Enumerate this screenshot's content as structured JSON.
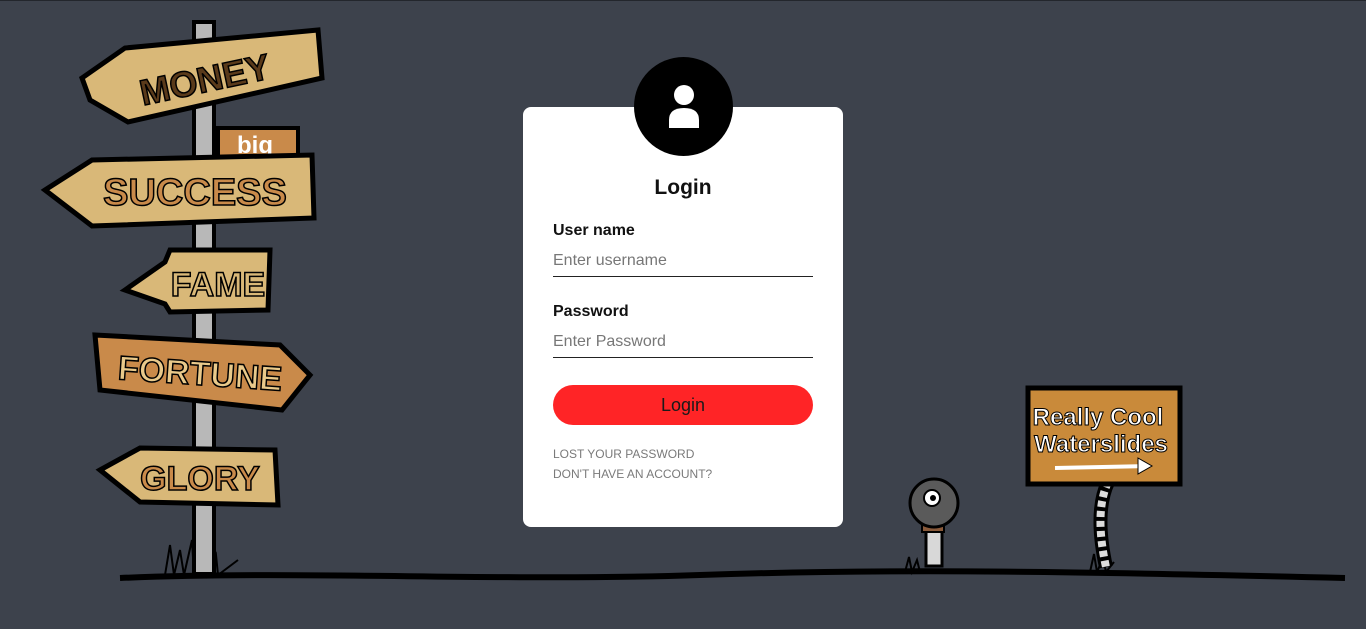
{
  "background": {
    "signpost_signs": [
      "MONEY",
      "big",
      "SUCCESS",
      "FAME",
      "FORTUNE",
      "GLORY"
    ],
    "waterslide_sign": [
      "Really Cool",
      "Waterslides"
    ],
    "color": "#3d424c"
  },
  "login_card": {
    "avatar_icon": "user-icon",
    "title": "Login",
    "username_label": "User name",
    "username_placeholder": "Enter username",
    "username_value": "",
    "password_label": "Password",
    "password_placeholder": "Enter Password",
    "password_value": "",
    "submit_label": "Login",
    "lost_password_link": "LOST YOUR PASSWORD",
    "signup_link": "DON'T HAVE AN ACCOUNT?",
    "accent_color": "#ff2426"
  }
}
